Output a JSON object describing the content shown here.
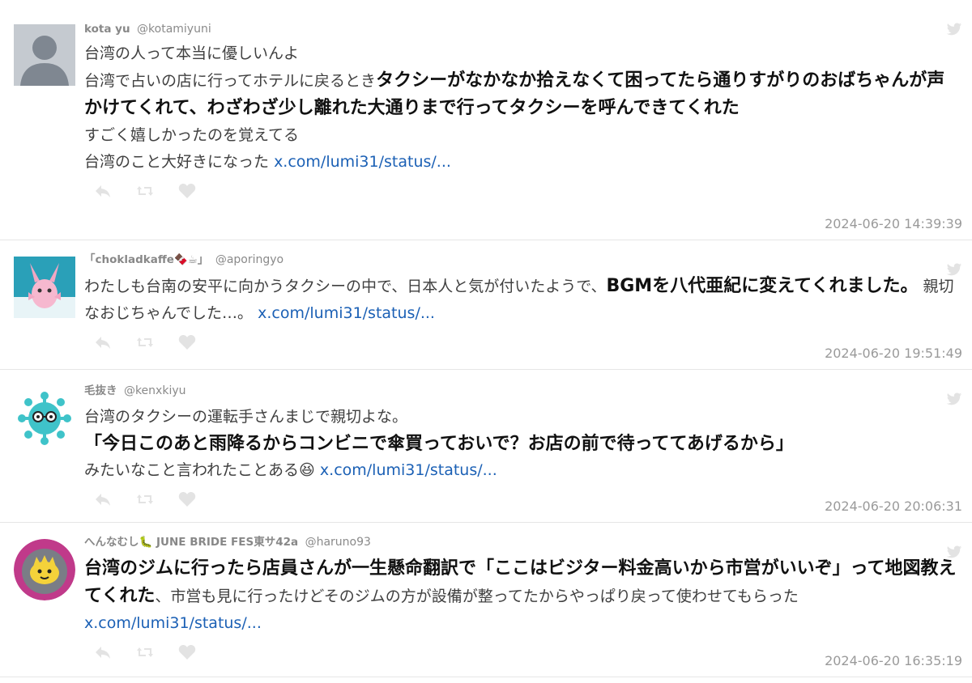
{
  "tweets": [
    {
      "name": "kota yu",
      "handle": "@kotamiyuni",
      "lines": [
        "台湾の人って本当に優しいんよ"
      ],
      "line2_plain": "台湾で占いの店に行ってホテルに戻るとき",
      "line2_bold": "タクシーがなかなか拾えなくて困ってたら通りすがりのおばちゃんが声かけてくれて、わざわざ少し離れた大通りまで行ってタクシーを呼んできてくれた",
      "line3": "すごく嬉しかったのを覚えてる",
      "line4": "台湾のこと大好きになった",
      "link": "x.com/lumi31/status/...",
      "time": "2024-06-20 14:39:39"
    },
    {
      "name": "「chokladkaffe🍫☕」",
      "handle": "@aporingyo",
      "plain1": "わたしも台南の安平に向かうタクシーの中で、日本人と気が付いたようで、",
      "bold1": "BGMを八代亜紀に変えてくれました。",
      "plain2": "親切なおじちゃんでした…。",
      "link": "x.com/lumi31/status/...",
      "time": "2024-06-20 19:51:49"
    },
    {
      "name": "毛抜き",
      "handle": "@kenxkiyu",
      "line1": "台湾のタクシーの運転手さんまじで親切よな。",
      "bold1": "「今日このあと雨降るからコンビニで傘買っておいで？お店の前で待っててあげるから」",
      "line3": "みたいなこと言われたことある😆",
      "link": "x.com/lumi31/status/...",
      "time": "2024-06-20 20:06:31"
    },
    {
      "name": "へんなむし🐛 JUNE BRIDE FES東サ42a",
      "handle": "@haruno93",
      "bold1": "台湾のジムに行ったら店員さんが一生懸命翻訳で「ここはビジター料金高いから市営がいいぞ」って地図教えてくれた",
      "plain1": "、市営も見に行ったけどそのジムの方が設備が整ってたからやっぱり戻って使わせてもらった",
      "link": "x.com/lumi31/status/...",
      "time": "2024-06-20 16:35:19"
    }
  ],
  "colors": {
    "link": "#1b60b5",
    "meta": "#8a8a8a",
    "icon": "#e3e3e3"
  }
}
